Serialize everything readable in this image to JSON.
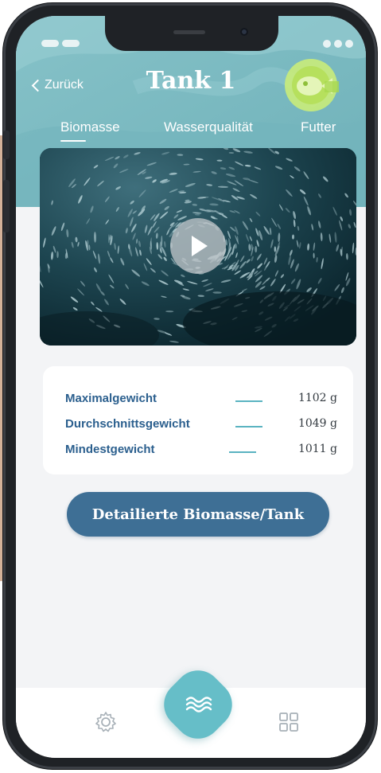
{
  "header": {
    "back_label": "Zurück",
    "title": "Tank 1"
  },
  "tabs": [
    {
      "label": "Biomasse",
      "active": true
    },
    {
      "label": "Wasserqualität",
      "active": false
    },
    {
      "label": "Futter",
      "active": false
    }
  ],
  "video": {
    "icon": "play-icon"
  },
  "stats": [
    {
      "label": "Maximalgewicht",
      "value": "1102 g"
    },
    {
      "label": "Durchschnittsgewicht",
      "value": "1049 g"
    },
    {
      "label": "Mindestgewicht",
      "value": "1011 g"
    }
  ],
  "cta": {
    "label": "Detailierte Biomasse/Tank"
  },
  "tabbar": {
    "left_icon": "settings-icon",
    "center_icon": "waves-icon",
    "right_icon": "grid-icon"
  },
  "colors": {
    "header_teal": "#7fbcc3",
    "accent_teal": "#66bec8",
    "primary_blue": "#3e6f95",
    "label_blue": "#2b5f8e",
    "badge_green": "#c9ec7a"
  }
}
